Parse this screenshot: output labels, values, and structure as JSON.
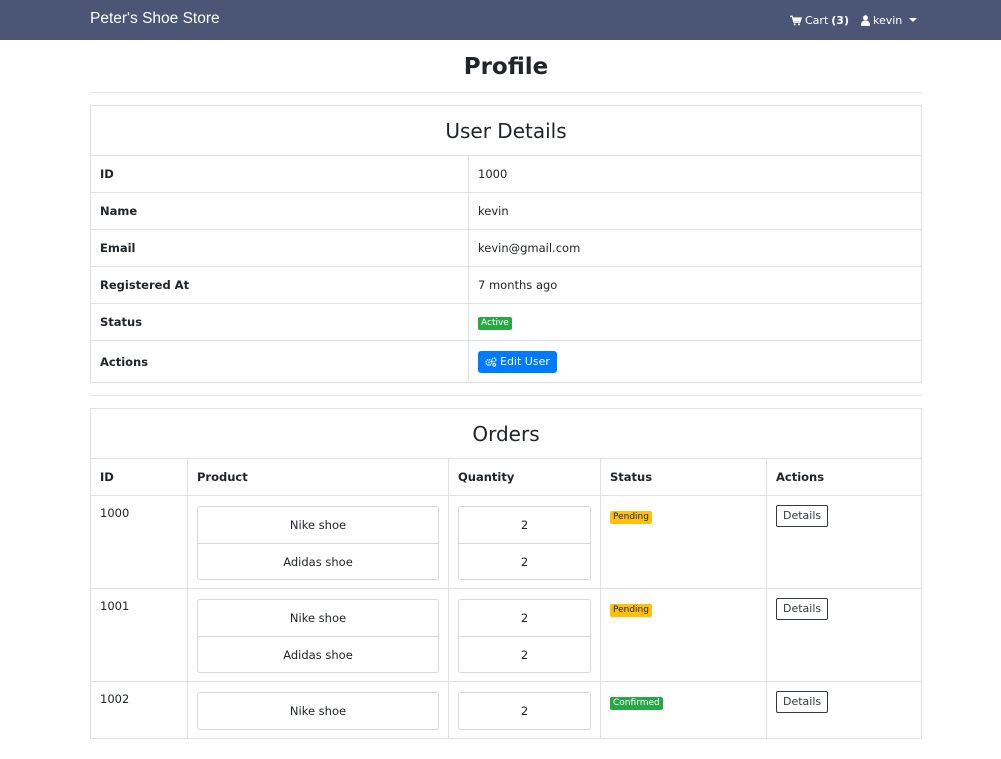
{
  "navbar": {
    "brand": "Peter's Shoe Store",
    "cart_label": "Cart",
    "cart_count": "(3)",
    "user_name": "kevin"
  },
  "page": {
    "title": "Profile"
  },
  "user_details": {
    "heading": "User Details",
    "rows": [
      {
        "label": "ID",
        "value": "1000"
      },
      {
        "label": "Name",
        "value": "kevin"
      },
      {
        "label": "Email",
        "value": "kevin@gmail.com"
      },
      {
        "label": "Registered At",
        "value": "7 months ago"
      },
      {
        "label": "Status",
        "value": "Active"
      },
      {
        "label": "Actions",
        "value": "Edit User"
      }
    ]
  },
  "orders": {
    "heading": "Orders",
    "columns": [
      "ID",
      "Product",
      "Quantity",
      "Status",
      "Actions"
    ],
    "rows": [
      {
        "id": "1000",
        "items": [
          {
            "product": "Nike shoe",
            "quantity": "2"
          },
          {
            "product": "Adidas shoe",
            "quantity": "2"
          }
        ],
        "status": "Pending",
        "action": "Details"
      },
      {
        "id": "1001",
        "items": [
          {
            "product": "Nike shoe",
            "quantity": "2"
          },
          {
            "product": "Adidas shoe",
            "quantity": "2"
          }
        ],
        "status": "Pending",
        "action": "Details"
      },
      {
        "id": "1002",
        "items": [
          {
            "product": "Nike shoe",
            "quantity": "2"
          }
        ],
        "status": "Confirmed",
        "action": "Details"
      }
    ]
  },
  "colors": {
    "navbar_bg": "#4b5677",
    "primary": "#007bff",
    "success": "#28a745",
    "warning": "#ffc107"
  },
  "icons": {
    "cart": "shopping-cart-icon",
    "user": "user-icon",
    "edit": "cogs-icon"
  }
}
